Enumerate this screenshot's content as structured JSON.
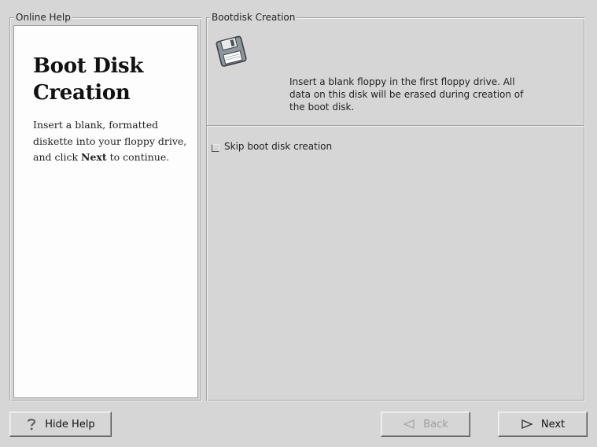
{
  "help": {
    "frame_label": "Online Help",
    "title_line1": "Boot Disk",
    "title_line2": "Creation",
    "text_before": "Insert a blank, formatted diskette into your floppy drive, and click ",
    "text_bold": "Next",
    "text_after": " to continue."
  },
  "main": {
    "frame_label": "Bootdisk Creation",
    "icon": "floppy-disk-icon",
    "info_text": "Insert a blank floppy in the first floppy drive. All data on this disk will be erased during creation of the boot disk.",
    "skip_checkbox": {
      "label": "Skip boot disk creation",
      "checked": false
    }
  },
  "buttons": {
    "hide_help": {
      "label": "Hide Help",
      "icon": "help-question-icon"
    },
    "back": {
      "label": "Back",
      "icon": "triangle-left-icon",
      "enabled": false
    },
    "next": {
      "label": "Next",
      "icon": "triangle-right-icon",
      "enabled": true
    }
  },
  "colors": {
    "window_bg": "#d6d6d6",
    "help_bg": "#fdfdfd",
    "disabled_text": "#9c9c9c"
  }
}
